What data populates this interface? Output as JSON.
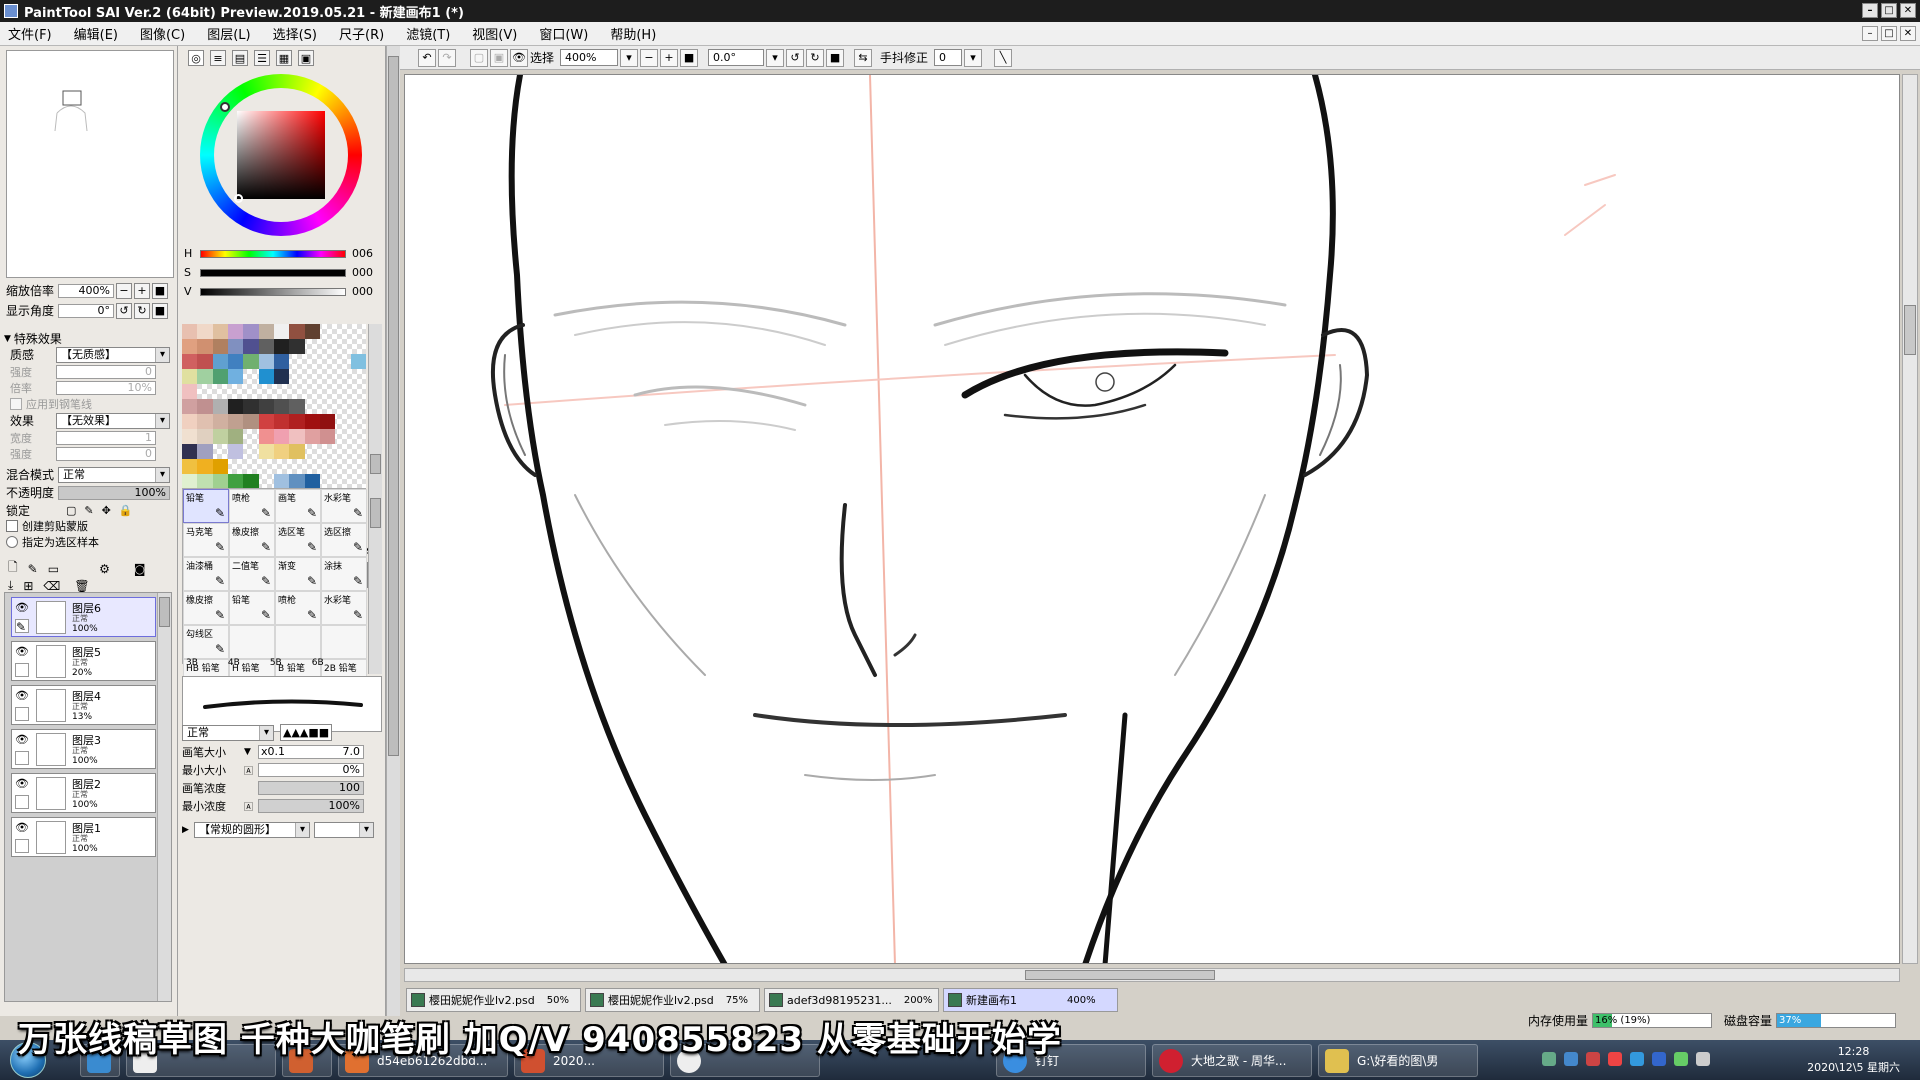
{
  "window": {
    "title": "PaintTool SAI Ver.2 (64bit) Preview.2019.05.21 - 新建画布1 (*)",
    "min": "–",
    "max": "□",
    "close": "✕"
  },
  "menu": [
    "文件(F)",
    "编辑(E)",
    "图像(C)",
    "图层(L)",
    "选择(S)",
    "尺子(R)",
    "滤镜(T)",
    "视图(V)",
    "窗口(W)",
    "帮助(H)"
  ],
  "navigator": {
    "zoom_label": "缩放倍率",
    "zoom_value": "400%",
    "angle_label": "显示角度",
    "angle_value": "0°"
  },
  "effects": {
    "header": "特殊效果",
    "texture_label": "质感",
    "texture_value": "【无质感】",
    "strength_label": "强度",
    "strength_value": "0",
    "scale_label": "倍率",
    "scale_value": "10%",
    "apply_label": "应用到钢笔线",
    "effect_label": "效果",
    "effect_value": "【无效果】",
    "width_label": "宽度",
    "width_value": "1",
    "intensity_label": "强度",
    "intensity_value": "0"
  },
  "layer_props": {
    "blend_label": "混合模式",
    "blend_value": "正常",
    "opacity_label": "不透明度",
    "opacity_value": "100%",
    "lock_label": "锁定",
    "clip_label": "创建剪贴蒙版",
    "sample_label": "指定为选区样本"
  },
  "layers": [
    {
      "name": "图层6",
      "mode": "正常",
      "opacity": "100%",
      "selected": true
    },
    {
      "name": "图层5",
      "mode": "正常",
      "opacity": "20%",
      "selected": false
    },
    {
      "name": "图层4",
      "mode": "正常",
      "opacity": "13%",
      "selected": false
    },
    {
      "name": "图层3",
      "mode": "正常",
      "opacity": "100%",
      "selected": false
    },
    {
      "name": "图层2",
      "mode": "正常",
      "opacity": "100%",
      "selected": false
    },
    {
      "name": "图层1",
      "mode": "正常",
      "opacity": "100%",
      "selected": false
    }
  ],
  "color": {
    "h_label": "H",
    "h_value": "006",
    "s_label": "S",
    "s_value": "000",
    "v_label": "V",
    "v_value": "000",
    "fg": "#000000",
    "bg": "#ffffff"
  },
  "swatches": [
    "#e8c0b0",
    "#f0d8c8",
    "#e0c0a0",
    "#c8a0d0",
    "#a090c8",
    "#c0b0a0",
    "#f0f0f0",
    "#905040",
    "#604030",
    "#fff",
    "#fff",
    "#fff",
    "#e0a080",
    "#d09070",
    "#b08060",
    "#8090c0",
    "#505090",
    "#606060",
    "#202020",
    "#303030",
    "#fff",
    "#fff",
    "#fff",
    "#fff",
    "#d06060",
    "#c05050",
    "#60a0d0",
    "#4080c0",
    "#70b070",
    "#a0c0e0",
    "#3060a0",
    "#fff",
    "#fff",
    "#fff",
    "#fff",
    "#80c0e0",
    "#e0e0a0",
    "#a0d0a0",
    "#50a070",
    "#70b0e0",
    "#fff",
    "#2090d0",
    "#203050",
    "#fff",
    "#fff",
    "#fff",
    "#fff",
    "#fff",
    "#f0c0c0",
    "#fff",
    "#fff",
    "#fff",
    "#fff",
    "#fff",
    "#fff",
    "#fff",
    "#fff",
    "#fff",
    "#fff",
    "#fff",
    "#d0a0a0",
    "#c09090",
    "#b0b0b0",
    "#202020",
    "#303030",
    "#404040",
    "#505050",
    "#606060",
    "#fff",
    "#fff",
    "#fff",
    "#fff",
    "#f0d0c0",
    "#e0c0b0",
    "#d0b0a0",
    "#c0a090",
    "#b09080",
    "#d04040",
    "#c03030",
    "#b02020",
    "#a01010",
    "#901010",
    "#fff",
    "#fff",
    "#f0e0d0",
    "#e0d0c0",
    "#c0d0a0",
    "#a0b080",
    "#fff",
    "#f09090",
    "#f0a0b0",
    "#f0c0c0",
    "#e0a0a0",
    "#d09090",
    "#fff",
    "#fff",
    "#303050",
    "#a0a0c0",
    "#fff",
    "#c0c0e0",
    "#fff",
    "#f0e0a0",
    "#f0d080",
    "#e0c060",
    "#fff",
    "#fff",
    "#fff",
    "#fff",
    "#f0c040",
    "#f0b020",
    "#e0a000",
    "#fff",
    "#fff",
    "#fff",
    "#fff",
    "#fff",
    "#fff",
    "#fff",
    "#fff",
    "#fff",
    "#e0f0d0",
    "#c0e0b0",
    "#a0d090",
    "#40a040",
    "#208020",
    "#fff",
    "#a0c0e0",
    "#6090c0",
    "#2060a0",
    "#fff",
    "#fff",
    "#fff",
    "#f0e0f0",
    "#d0c0e0",
    "#b0a0d0",
    "#9080c0",
    "#7060b0",
    "#5040a0",
    "#fff",
    "#fff",
    "#203040",
    "#fff",
    "#404040",
    "#000000",
    "#a0d0f0",
    "#80c0f0",
    "#60b0f0",
    "#e04040",
    "#fff",
    "#fff",
    "#fff",
    "#fff",
    "#fff",
    "#30c0c0",
    "#20a0a0",
    "#fff"
  ],
  "tools": {
    "select_rect": "⬚",
    "lasso": "⌒",
    "wand": "✦",
    "shape": "⬢",
    "text": "T",
    "move": "✥",
    "zoom": "🔍",
    "rotate": "↻",
    "hand": "✋",
    "picker": "✎",
    "swap": "⇆"
  },
  "brushes": [
    {
      "name": "铅笔",
      "sel": true
    },
    {
      "name": "喷枪",
      "sel": false
    },
    {
      "name": "画笔",
      "sel": false
    },
    {
      "name": "水彩笔",
      "sel": false
    },
    {
      "name": "马克笔",
      "sel": false
    },
    {
      "name": "橡皮擦",
      "sel": false
    },
    {
      "name": "选区笔",
      "sel": false
    },
    {
      "name": "选区擦",
      "sel": false
    },
    {
      "name": "油漆桶",
      "sel": false
    },
    {
      "name": "二值笔",
      "sel": false
    },
    {
      "name": "渐变",
      "sel": false
    },
    {
      "name": "涂抹",
      "sel": false
    },
    {
      "name": "橡皮擦",
      "sel": false
    },
    {
      "name": "铅笔",
      "sel": false
    },
    {
      "name": "喷枪",
      "sel": false
    },
    {
      "name": "水彩笔",
      "sel": false
    },
    {
      "name": "勾线区",
      "sel": false
    },
    {
      "name": "",
      "sel": false
    },
    {
      "name": "",
      "sel": false
    },
    {
      "name": "",
      "sel": false
    },
    {
      "name": "HB 铅笔",
      "sel": false
    },
    {
      "name": "H 铅笔",
      "sel": false
    },
    {
      "name": "B 铅笔",
      "sel": false
    },
    {
      "name": "2B 铅笔",
      "sel": false
    }
  ],
  "brush_row_labels": [
    "3B",
    "4B",
    "5B",
    "6B"
  ],
  "brush_props": {
    "mode_value": "正常",
    "size_label": "画笔大小",
    "size_mult": "x0.1",
    "size_value": "7.0",
    "min_size_label": "最小大小",
    "min_size_value": "0%",
    "density_label": "画笔浓度",
    "density_value": "100",
    "min_density_label": "最小浓度",
    "min_density_value": "100%",
    "shape_value": "【常规的圆形】"
  },
  "canvas_toolbar": {
    "select_label": "选择",
    "zoom_value": "400%",
    "angle_value": "0.0°",
    "stabilizer_label": "手抖修正",
    "stabilizer_value": "0"
  },
  "tabs": [
    {
      "name": "樱田妮妮作业lv2.psd",
      "zoom": "50%"
    },
    {
      "name": "樱田妮妮作业lv2.psd",
      "zoom": "75%"
    },
    {
      "name": "adef3d98195231...",
      "zoom": "200%"
    },
    {
      "name": "新建画布1",
      "zoom": "400%"
    }
  ],
  "status": {
    "mem_label": "内存使用量",
    "mem_value": "16% (19%)",
    "mem_fraction": 0.16,
    "disk_label": "磁盘容量",
    "disk_value": "37%",
    "disk_fraction": 0.37
  },
  "caption": "万张线稿草图 千种大咖笔刷 加Q/V 940855823 从零基础开始学",
  "taskbar": {
    "items": [
      {
        "label": "",
        "color": "#3a8bd0"
      },
      {
        "label": "",
        "color": "#d06030"
      },
      {
        "label": "d54eb61262dbd...",
        "color": "#e07030"
      },
      {
        "label": "2020...",
        "color": "#d05030"
      },
      {
        "label": "",
        "color": "#eeeeee"
      },
      {
        "label": "钉钉",
        "color": "#3a8ee0"
      },
      {
        "label": "大地之歌 - 周华...",
        "color": "#d02030"
      },
      {
        "label": "G:\\好看的图\\男",
        "color": "#e0c050"
      }
    ],
    "time": "12:28",
    "date": "2020\\12\\5 星期六"
  }
}
